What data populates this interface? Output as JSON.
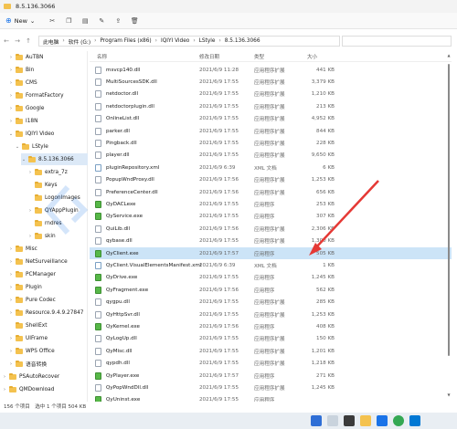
{
  "window": {
    "title": "8.5.136.3066"
  },
  "toolbar": {
    "new_label": "New"
  },
  "breadcrumb": [
    "此电脑",
    "软件 (G:)",
    "Program Files (x86)",
    "IQIYI Video",
    "LStyle",
    "8.5.136.3066"
  ],
  "columns": {
    "name": "名称",
    "date": "修改日期",
    "type": "类型",
    "size": "大小"
  },
  "sidebar": {
    "items": [
      {
        "label": "AuTBN",
        "level": 2,
        "chev": "›"
      },
      {
        "label": "Bin",
        "level": 2,
        "chev": "›"
      },
      {
        "label": "CMS",
        "level": 2,
        "chev": "›"
      },
      {
        "label": "FormatFactory",
        "level": 2,
        "chev": "›"
      },
      {
        "label": "Google",
        "level": 2,
        "chev": "›"
      },
      {
        "label": "I18N",
        "level": 2,
        "chev": "›"
      },
      {
        "label": "IQIYI Video",
        "level": 2,
        "chev": "⌄"
      },
      {
        "label": "LStyle",
        "level": 3,
        "chev": "⌄"
      },
      {
        "label": "8.5.136.3066",
        "level": 4,
        "chev": "⌄",
        "selected": true
      },
      {
        "label": "extra_7z",
        "level": 5,
        "chev": "›"
      },
      {
        "label": "Keys",
        "level": 5,
        "chev": ""
      },
      {
        "label": "LogonImages",
        "level": 5,
        "chev": ""
      },
      {
        "label": "QYAppPlugin",
        "level": 5,
        "chev": "›"
      },
      {
        "label": "rndres",
        "level": 5,
        "chev": ""
      },
      {
        "label": "skin",
        "level": 5,
        "chev": "›"
      },
      {
        "label": "Misc",
        "level": 2,
        "chev": "›"
      },
      {
        "label": "NetSurveillance",
        "level": 2,
        "chev": "›"
      },
      {
        "label": "PCManager",
        "level": 2,
        "chev": "›"
      },
      {
        "label": "Plugin",
        "level": 2,
        "chev": "›"
      },
      {
        "label": "Pure Codec",
        "level": 2,
        "chev": "›"
      },
      {
        "label": "Resource.9.4.9.27847",
        "level": 2,
        "chev": "›"
      },
      {
        "label": "ShellExt",
        "level": 2,
        "chev": ""
      },
      {
        "label": "UIFrame",
        "level": 2,
        "chev": "›"
      },
      {
        "label": "WPS Office",
        "level": 2,
        "chev": "›"
      },
      {
        "label": "语音转换",
        "level": 2,
        "chev": "›"
      },
      {
        "label": "PSAutoRecover",
        "level": 1,
        "chev": "›"
      },
      {
        "label": "QMDownload",
        "level": 1,
        "chev": "›"
      }
    ]
  },
  "files": [
    {
      "name": "msvcp140.dll",
      "date": "2021/6/9 11:28",
      "type": "应用程序扩展",
      "size": "441 KB",
      "kind": "dll"
    },
    {
      "name": "MultiSourcesSDK.dll",
      "date": "2021/6/9 17:55",
      "type": "应用程序扩展",
      "size": "3,379 KB",
      "kind": "dll"
    },
    {
      "name": "netdoctor.dll",
      "date": "2021/6/9 17:55",
      "type": "应用程序扩展",
      "size": "1,210 KB",
      "kind": "dll"
    },
    {
      "name": "netdoctorplugin.dll",
      "date": "2021/6/9 17:55",
      "type": "应用程序扩展",
      "size": "213 KB",
      "kind": "dll"
    },
    {
      "name": "OnlineList.dll",
      "date": "2021/6/9 17:55",
      "type": "应用程序扩展",
      "size": "4,952 KB",
      "kind": "dll"
    },
    {
      "name": "parker.dll",
      "date": "2021/6/9 17:55",
      "type": "应用程序扩展",
      "size": "844 KB",
      "kind": "dll"
    },
    {
      "name": "Pingback.dll",
      "date": "2021/6/9 17:55",
      "type": "应用程序扩展",
      "size": "228 KB",
      "kind": "dll"
    },
    {
      "name": "player.dll",
      "date": "2021/6/9 17:55",
      "type": "应用程序扩展",
      "size": "9,650 KB",
      "kind": "dll"
    },
    {
      "name": "pluginRepository.xml",
      "date": "2021/6/9 6:39",
      "type": "XML 文档",
      "size": "6 KB",
      "kind": "xml"
    },
    {
      "name": "PopupWndProxy.dll",
      "date": "2021/6/9 17:56",
      "type": "应用程序扩展",
      "size": "1,253 KB",
      "kind": "dll"
    },
    {
      "name": "PreferenceCenter.dll",
      "date": "2021/6/9 17:56",
      "type": "应用程序扩展",
      "size": "656 KB",
      "kind": "dll"
    },
    {
      "name": "QyDACLexe",
      "date": "2021/6/9 17:55",
      "type": "应用程序",
      "size": "253 KB",
      "kind": "exe"
    },
    {
      "name": "QyService.exe",
      "date": "2021/6/9 17:55",
      "type": "应用程序",
      "size": "307 KB",
      "kind": "exe"
    },
    {
      "name": "QuiLib.dll",
      "date": "2021/6/9 17:56",
      "type": "应用程序扩展",
      "size": "2,306 KB",
      "kind": "dll"
    },
    {
      "name": "qybase.dll",
      "date": "2021/6/9 17:55",
      "type": "应用程序扩展",
      "size": "1,300 KB",
      "kind": "dll"
    },
    {
      "name": "QyClient.exe",
      "date": "2021/6/9 17:57",
      "type": "应用程序",
      "size": "505 KB",
      "kind": "exe",
      "selected": true
    },
    {
      "name": "QyClient.VisualElementsManifest.xml",
      "date": "2021/6/9 6:39",
      "type": "XML 文档",
      "size": "1 KB",
      "kind": "xml"
    },
    {
      "name": "QyDrive.exe",
      "date": "2021/6/9 17:55",
      "type": "应用程序",
      "size": "1,245 KB",
      "kind": "exe"
    },
    {
      "name": "QyFragment.exe",
      "date": "2021/6/9 17:56",
      "type": "应用程序",
      "size": "562 KB",
      "kind": "exe"
    },
    {
      "name": "qygpu.dll",
      "date": "2021/6/9 17:55",
      "type": "应用程序扩展",
      "size": "285 KB",
      "kind": "dll"
    },
    {
      "name": "QyHttpSvr.dll",
      "date": "2021/6/9 17:55",
      "type": "应用程序扩展",
      "size": "1,253 KB",
      "kind": "dll"
    },
    {
      "name": "QyKernel.exe",
      "date": "2021/6/9 17:56",
      "type": "应用程序",
      "size": "408 KB",
      "kind": "exe"
    },
    {
      "name": "QyLogUp.dll",
      "date": "2021/6/9 17:55",
      "type": "应用程序扩展",
      "size": "150 KB",
      "kind": "dll"
    },
    {
      "name": "QyMisc.dll",
      "date": "2021/6/9 17:55",
      "type": "应用程序扩展",
      "size": "1,201 KB",
      "kind": "dll"
    },
    {
      "name": "qypdh.dll",
      "date": "2021/6/9 17:55",
      "type": "应用程序扩展",
      "size": "1,218 KB",
      "kind": "dll"
    },
    {
      "name": "QyPlayer.exe",
      "date": "2021/6/9 17:57",
      "type": "应用程序",
      "size": "271 KB",
      "kind": "exe"
    },
    {
      "name": "QyPopWndDll.dll",
      "date": "2021/6/9 17:55",
      "type": "应用程序扩展",
      "size": "1,245 KB",
      "kind": "dll"
    },
    {
      "name": "QyUninst.exe",
      "date": "2021/6/9 17:55",
      "type": "应用程序",
      "size": "",
      "kind": "exe"
    }
  ],
  "status": {
    "text": "156 个项目　选中 1 个项目 504 KB"
  },
  "colors": {
    "selection": "#cce4f7",
    "folder": "#f4c24f",
    "arrow": "#e53935"
  }
}
